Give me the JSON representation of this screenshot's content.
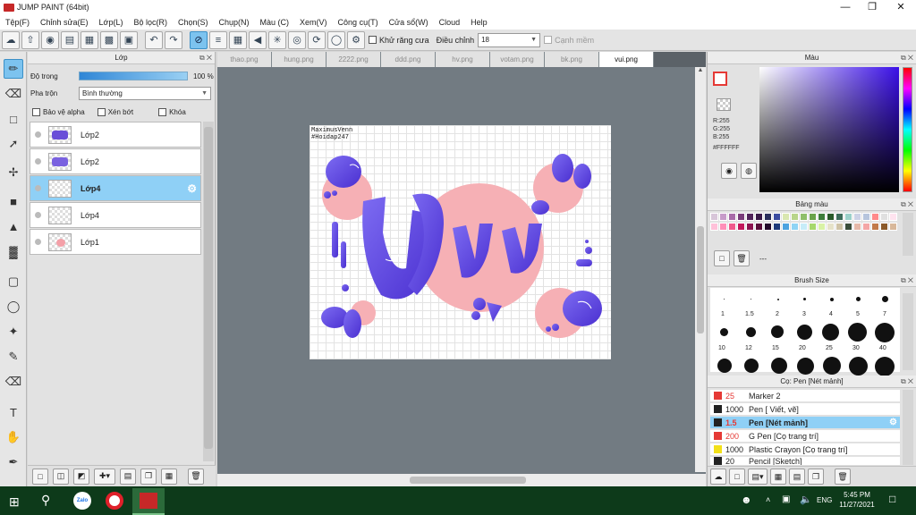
{
  "window": {
    "title": "JUMP PAINT (64bit)"
  },
  "menu": [
    "Tệp(F)",
    "Chỉnh sửa(E)",
    "Lớp(L)",
    "Bộ lọc(R)",
    "Chọn(S)",
    "Chụp(N)",
    "Màu (C)",
    "Xem(V)",
    "Công cụ(T)",
    "Cửa sổ(W)",
    "Cloud",
    "Help"
  ],
  "toolbar": {
    "antialias_label": "Khử răng cưa",
    "adjust_label": "Điều chỉnh",
    "adjust_value": "18",
    "soft_edge_label": "Cạnh mềm"
  },
  "layer_panel": {
    "title": "Lớp",
    "opacity_label": "Độ trong",
    "opacity_value": "100 %",
    "opacity_fraction": 1.0,
    "blend_label": "Pha trộn",
    "blend_value": "Bình thường",
    "protect_alpha": "Bảo vệ alpha",
    "clip": "Xén bớt",
    "lock": "Khóa",
    "layers": [
      {
        "name": "Lớp2",
        "selected": false
      },
      {
        "name": "Lớp2",
        "selected": false
      },
      {
        "name": "Lớp4",
        "selected": true
      },
      {
        "name": "Lớp4",
        "selected": false
      },
      {
        "name": "Lớp1",
        "selected": false
      }
    ]
  },
  "tabs": [
    "thao.png",
    "hung.png",
    "2222.png",
    "ddd.png",
    "hv.png",
    "votam.png",
    "bk.png",
    "vui.png"
  ],
  "active_tab": "vui.png",
  "canvas": {
    "watermark_line1": "MaximusVenn",
    "watermark_line2": "#Hoidap247",
    "artwork_text": "Vui"
  },
  "color_panel": {
    "title": "Màu",
    "r": "R:255",
    "g": "G:255",
    "b": "B:255",
    "hex": "#FFFFFF",
    "current_color": "#e53935"
  },
  "palette_panel": {
    "title": "Bảng màu",
    "footer_text": "---",
    "colors": [
      "#d8c6d9",
      "#c79bc9",
      "#a86aa8",
      "#7a3c7a",
      "#51245a",
      "#3a1a48",
      "#2b2f5c",
      "#3b4ca0",
      "#d9e7b0",
      "#b8d58a",
      "#8fbf6a",
      "#6aa34a",
      "#3e7d3a",
      "#2a5a2a",
      "#3d6c5a",
      "#9bd0c9",
      "#cdd2e6",
      "#b7c5dd",
      "#ff8a8a",
      "#e0e0e0",
      "#ffe3ef",
      "#ffc1d9",
      "#ff8fb8",
      "#f05a8c",
      "#c2185b",
      "#8c1450",
      "#5a0f3a",
      "#240a2a",
      "#1f3b7a",
      "#4da3e0",
      "#8fd4f5",
      "#c7ecf8",
      "#a6d86d",
      "#d9f2a6",
      "#e6e2c9",
      "#cfc3a7",
      "#3b4d3a",
      "#e6b8a8",
      "#f4a6a6",
      "#c27a4a",
      "#8c5a2a",
      "#d8b89a"
    ]
  },
  "brush_size_panel": {
    "title": "Brush Size",
    "sizes": [
      "1",
      "1.5",
      "2",
      "3",
      "4",
      "5",
      "7",
      "10",
      "12",
      "15",
      "20",
      "25",
      "30",
      "40"
    ]
  },
  "brush_panel": {
    "title": "Cọ: Pen [Nét mảnh]",
    "brushes": [
      {
        "size": "25",
        "name": "Marker 2",
        "color": "#e53935",
        "selected": false
      },
      {
        "size": "1000",
        "name": "Pen [ Viết, vẽ]",
        "color": "#222222",
        "selected": false
      },
      {
        "size": "1.5",
        "name": "Pen [Nét mảnh]",
        "color": "#222222",
        "selected": true
      },
      {
        "size": "200",
        "name": "G Pen [Cọ trang trí]",
        "color": "#e53935",
        "selected": false
      },
      {
        "size": "1000",
        "name": "Plastic Crayon [Cọ trang trí]",
        "color": "#f2e019",
        "selected": false
      },
      {
        "size": "20",
        "name": "Pencil [Sketch]",
        "color": "#222222",
        "selected": false
      }
    ]
  },
  "taskbar": {
    "lang": "ENG",
    "time": "5:45 PM",
    "date": "11/27/2021",
    "zalo": "Zalo"
  }
}
